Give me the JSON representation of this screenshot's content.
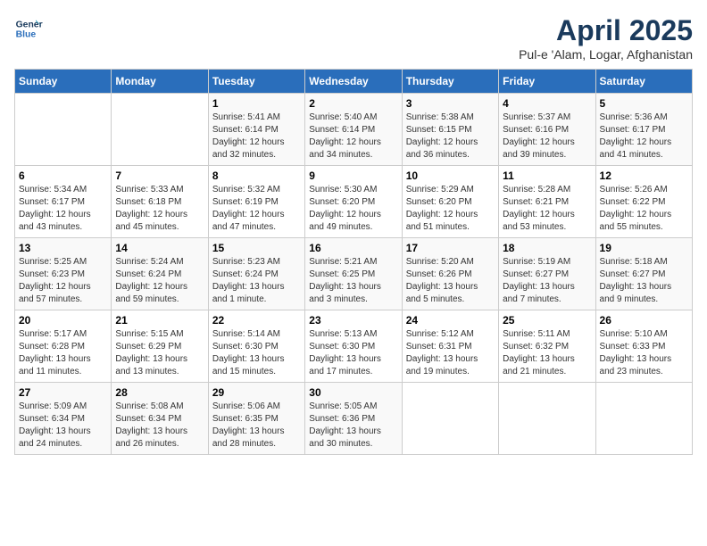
{
  "header": {
    "logo_line1": "General",
    "logo_line2": "Blue",
    "title": "April 2025",
    "subtitle": "Pul-e 'Alam, Logar, Afghanistan"
  },
  "weekdays": [
    "Sunday",
    "Monday",
    "Tuesday",
    "Wednesday",
    "Thursday",
    "Friday",
    "Saturday"
  ],
  "weeks": [
    [
      {
        "day": "",
        "content": ""
      },
      {
        "day": "",
        "content": ""
      },
      {
        "day": "1",
        "content": "Sunrise: 5:41 AM\nSunset: 6:14 PM\nDaylight: 12 hours\nand 32 minutes."
      },
      {
        "day": "2",
        "content": "Sunrise: 5:40 AM\nSunset: 6:14 PM\nDaylight: 12 hours\nand 34 minutes."
      },
      {
        "day": "3",
        "content": "Sunrise: 5:38 AM\nSunset: 6:15 PM\nDaylight: 12 hours\nand 36 minutes."
      },
      {
        "day": "4",
        "content": "Sunrise: 5:37 AM\nSunset: 6:16 PM\nDaylight: 12 hours\nand 39 minutes."
      },
      {
        "day": "5",
        "content": "Sunrise: 5:36 AM\nSunset: 6:17 PM\nDaylight: 12 hours\nand 41 minutes."
      }
    ],
    [
      {
        "day": "6",
        "content": "Sunrise: 5:34 AM\nSunset: 6:17 PM\nDaylight: 12 hours\nand 43 minutes."
      },
      {
        "day": "7",
        "content": "Sunrise: 5:33 AM\nSunset: 6:18 PM\nDaylight: 12 hours\nand 45 minutes."
      },
      {
        "day": "8",
        "content": "Sunrise: 5:32 AM\nSunset: 6:19 PM\nDaylight: 12 hours\nand 47 minutes."
      },
      {
        "day": "9",
        "content": "Sunrise: 5:30 AM\nSunset: 6:20 PM\nDaylight: 12 hours\nand 49 minutes."
      },
      {
        "day": "10",
        "content": "Sunrise: 5:29 AM\nSunset: 6:20 PM\nDaylight: 12 hours\nand 51 minutes."
      },
      {
        "day": "11",
        "content": "Sunrise: 5:28 AM\nSunset: 6:21 PM\nDaylight: 12 hours\nand 53 minutes."
      },
      {
        "day": "12",
        "content": "Sunrise: 5:26 AM\nSunset: 6:22 PM\nDaylight: 12 hours\nand 55 minutes."
      }
    ],
    [
      {
        "day": "13",
        "content": "Sunrise: 5:25 AM\nSunset: 6:23 PM\nDaylight: 12 hours\nand 57 minutes."
      },
      {
        "day": "14",
        "content": "Sunrise: 5:24 AM\nSunset: 6:24 PM\nDaylight: 12 hours\nand 59 minutes."
      },
      {
        "day": "15",
        "content": "Sunrise: 5:23 AM\nSunset: 6:24 PM\nDaylight: 13 hours\nand 1 minute."
      },
      {
        "day": "16",
        "content": "Sunrise: 5:21 AM\nSunset: 6:25 PM\nDaylight: 13 hours\nand 3 minutes."
      },
      {
        "day": "17",
        "content": "Sunrise: 5:20 AM\nSunset: 6:26 PM\nDaylight: 13 hours\nand 5 minutes."
      },
      {
        "day": "18",
        "content": "Sunrise: 5:19 AM\nSunset: 6:27 PM\nDaylight: 13 hours\nand 7 minutes."
      },
      {
        "day": "19",
        "content": "Sunrise: 5:18 AM\nSunset: 6:27 PM\nDaylight: 13 hours\nand 9 minutes."
      }
    ],
    [
      {
        "day": "20",
        "content": "Sunrise: 5:17 AM\nSunset: 6:28 PM\nDaylight: 13 hours\nand 11 minutes."
      },
      {
        "day": "21",
        "content": "Sunrise: 5:15 AM\nSunset: 6:29 PM\nDaylight: 13 hours\nand 13 minutes."
      },
      {
        "day": "22",
        "content": "Sunrise: 5:14 AM\nSunset: 6:30 PM\nDaylight: 13 hours\nand 15 minutes."
      },
      {
        "day": "23",
        "content": "Sunrise: 5:13 AM\nSunset: 6:30 PM\nDaylight: 13 hours\nand 17 minutes."
      },
      {
        "day": "24",
        "content": "Sunrise: 5:12 AM\nSunset: 6:31 PM\nDaylight: 13 hours\nand 19 minutes."
      },
      {
        "day": "25",
        "content": "Sunrise: 5:11 AM\nSunset: 6:32 PM\nDaylight: 13 hours\nand 21 minutes."
      },
      {
        "day": "26",
        "content": "Sunrise: 5:10 AM\nSunset: 6:33 PM\nDaylight: 13 hours\nand 23 minutes."
      }
    ],
    [
      {
        "day": "27",
        "content": "Sunrise: 5:09 AM\nSunset: 6:34 PM\nDaylight: 13 hours\nand 24 minutes."
      },
      {
        "day": "28",
        "content": "Sunrise: 5:08 AM\nSunset: 6:34 PM\nDaylight: 13 hours\nand 26 minutes."
      },
      {
        "day": "29",
        "content": "Sunrise: 5:06 AM\nSunset: 6:35 PM\nDaylight: 13 hours\nand 28 minutes."
      },
      {
        "day": "30",
        "content": "Sunrise: 5:05 AM\nSunset: 6:36 PM\nDaylight: 13 hours\nand 30 minutes."
      },
      {
        "day": "",
        "content": ""
      },
      {
        "day": "",
        "content": ""
      },
      {
        "day": "",
        "content": ""
      }
    ]
  ]
}
